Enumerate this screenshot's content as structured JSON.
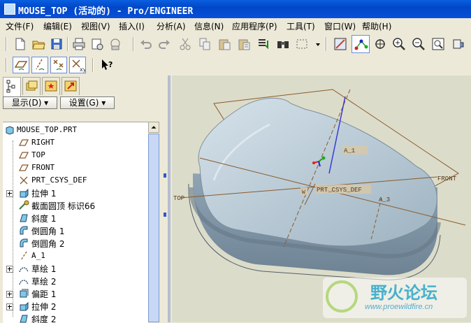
{
  "window": {
    "title": "MOUSE_TOP (活动的) - Pro/ENGINEER"
  },
  "menu": [
    {
      "label": "文件(F)"
    },
    {
      "label": "编辑(E)"
    },
    {
      "label": "视图(V)"
    },
    {
      "label": "插入(I)"
    },
    {
      "label": "分析(A)"
    },
    {
      "label": "信息(N)"
    },
    {
      "label": "应用程序(P)"
    },
    {
      "label": "工具(T)"
    },
    {
      "label": "窗口(W)"
    },
    {
      "label": "帮助(H)"
    }
  ],
  "toolbar_icons": [
    "new-icon",
    "open-icon",
    "save-icon",
    "print-icon",
    "send-icon",
    "email-icon",
    "undo-icon",
    "redo-icon",
    "cut-icon",
    "copy-icon",
    "paste-icon",
    "paste-special-icon",
    "regenerate-icon",
    "find-icon",
    "select-box-icon",
    "repaint-icon",
    "spin-center-icon",
    "orient-icon",
    "zoom-in-icon",
    "zoom-out-icon",
    "refit-icon",
    "view-manager-icon"
  ],
  "datum_toolbar_icons": [
    "datum-plane-display-icon",
    "datum-axis-display-icon",
    "datum-point-display-icon",
    "coordinate-system-display-icon",
    "whats-this-icon"
  ],
  "navigator": {
    "show_label": "显示(D) ▾",
    "settings_label": "设置(G) ▾",
    "tree": [
      {
        "label": "MOUSE_TOP.PRT",
        "icon": "part-icon",
        "expandable": false
      },
      {
        "label": "RIGHT",
        "icon": "datum-plane-icon",
        "expandable": false
      },
      {
        "label": "TOP",
        "icon": "datum-plane-icon",
        "expandable": false
      },
      {
        "label": "FRONT",
        "icon": "datum-plane-icon",
        "expandable": false
      },
      {
        "label": "PRT_CSYS_DEF",
        "icon": "csys-icon",
        "expandable": false
      },
      {
        "label": "拉伸 1",
        "icon": "extrude-icon",
        "expandable": true
      },
      {
        "label": "截面圆顶 标识66",
        "icon": "section-dome-icon",
        "expandable": false
      },
      {
        "label": "斜度 1",
        "icon": "draft-icon",
        "expandable": false
      },
      {
        "label": "倒圆角 1",
        "icon": "round-icon",
        "expandable": false
      },
      {
        "label": "倒圆角 2",
        "icon": "round-icon",
        "expandable": false
      },
      {
        "label": "A_1",
        "icon": "datum-axis-icon",
        "expandable": false
      },
      {
        "label": "草绘 1",
        "icon": "sketch-icon",
        "expandable": true
      },
      {
        "label": "草绘 2",
        "icon": "sketch-icon",
        "expandable": false
      },
      {
        "label": "偏距 1",
        "icon": "offset-icon",
        "expandable": true
      },
      {
        "label": "拉伸 2",
        "icon": "extrude-icon",
        "expandable": true
      },
      {
        "label": "斜度 2",
        "icon": "draft-icon",
        "expandable": false
      }
    ]
  },
  "viewport": {
    "labels": {
      "front": "FRONT",
      "top": "TOP",
      "a1": "A_1",
      "a3": "A_3",
      "csys": "PRT_CSYS_DEF",
      "w": "W"
    },
    "watermark": {
      "title": "野火论坛",
      "url": "www.proewildfire.cn"
    }
  },
  "colors": {
    "titlebar": "#0a5fe0",
    "model": "#a9bccb",
    "datum": "#8a5a2a",
    "background": "#dcdcca"
  }
}
